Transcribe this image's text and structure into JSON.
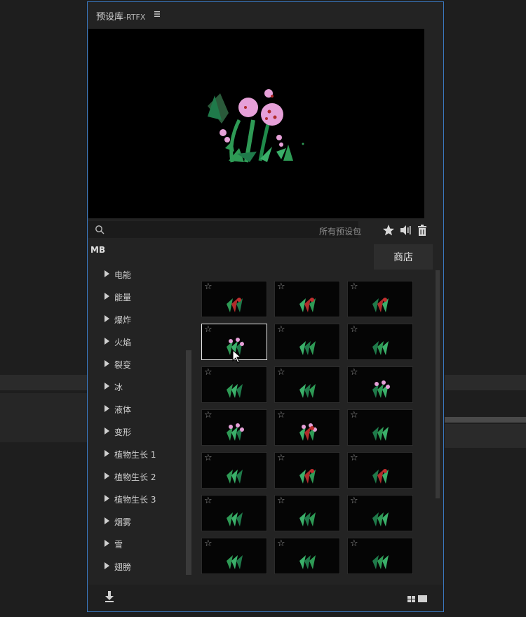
{
  "panel": {
    "title": "预设库",
    "title_suffix": "-RTFX"
  },
  "search": {
    "placeholder": "",
    "scope_label": "所有预设包"
  },
  "library": {
    "pack_label": "MB",
    "store_button": "商店"
  },
  "categories": [
    {
      "label": "电能"
    },
    {
      "label": "能量"
    },
    {
      "label": "爆炸"
    },
    {
      "label": "火焰"
    },
    {
      "label": "裂变"
    },
    {
      "label": "冰"
    },
    {
      "label": "液体"
    },
    {
      "label": "变形"
    },
    {
      "label": "植物生长 1"
    },
    {
      "label": "植物生长 2"
    },
    {
      "label": "植物生长 3"
    },
    {
      "label": "烟雾"
    },
    {
      "label": "雪"
    },
    {
      "label": "翅膀"
    }
  ],
  "presets": {
    "rows": 7,
    "columns": 3,
    "selected_index": 3,
    "thumbnails": [
      "plant-red",
      "plant-red-2",
      "plant-red-3",
      "pink-flowers",
      "green-pod",
      "green-sprout",
      "green-shrub",
      "green-leaves",
      "flower-mix",
      "pink-stem",
      "red-flowers",
      "green-curl",
      "green-leaf",
      "red-buds",
      "red-leaf",
      "green-stalk",
      "green-stalk-2",
      "green-stalk-3",
      "grass-1",
      "grass-2",
      "grass-3"
    ]
  },
  "icons": {
    "menu": "hamburger-icon",
    "search": "search-icon",
    "favorite": "star-icon",
    "audio": "speaker-icon",
    "delete": "trash-icon",
    "download": "download-icon",
    "grid_view": "grid-view-icon",
    "list_view": "large-view-icon"
  },
  "colors": {
    "accent_border": "#3a78c0",
    "panel_bg": "#232323",
    "preview_bg": "#000000",
    "leaf_green": "#2e9a55",
    "flower_pink": "#e6a0d8",
    "flower_red": "#b02b2b"
  }
}
